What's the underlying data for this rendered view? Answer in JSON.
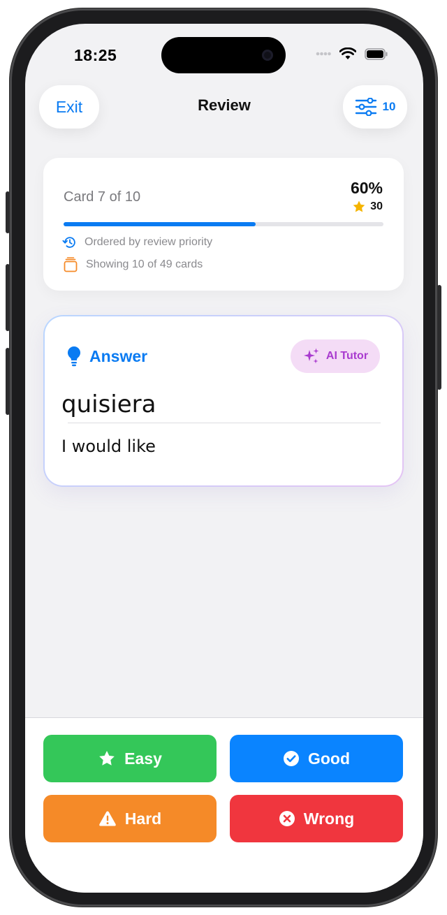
{
  "status_bar": {
    "time": "18:25"
  },
  "nav": {
    "exit_label": "Exit",
    "title": "Review",
    "filter_count": "10"
  },
  "progress": {
    "card_label": "Card 7 of 10",
    "percent_label": "60%",
    "stars_count": "30",
    "fraction": 0.6,
    "order_text": "Ordered by review priority",
    "showing_text": "Showing 10 of 49 cards"
  },
  "answer_card": {
    "heading": "Answer",
    "ai_tutor_label": "AI Tutor",
    "word": "quisiera",
    "meaning": "I would like"
  },
  "grades": {
    "easy": "Easy",
    "good": "Good",
    "hard": "Hard",
    "wrong": "Wrong"
  },
  "colors": {
    "accent": "#0A7BF2",
    "easy": "#34C759",
    "good": "#0A84FF",
    "hard": "#F58A28",
    "wrong": "#F0363E",
    "ai_tutor": "#A93BCF",
    "star": "#F5B400"
  },
  "icons": [
    "wifi-icon",
    "battery-icon",
    "signal-icon",
    "sliders-icon",
    "star-icon",
    "history-icon",
    "cards-icon",
    "lightbulb-icon",
    "sparkles-icon",
    "checkmark-circle-icon",
    "warning-icon",
    "x-circle-icon"
  ]
}
